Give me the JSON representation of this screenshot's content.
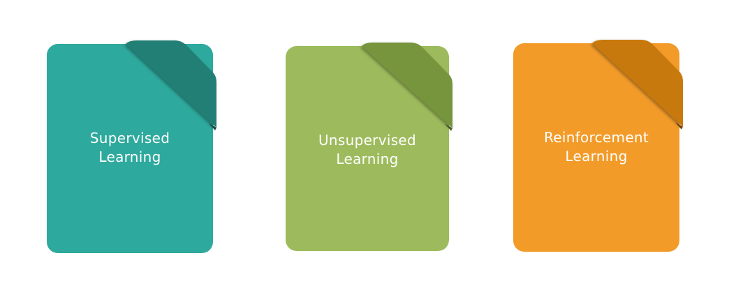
{
  "cards": [
    {
      "line1": "Supervised",
      "line2": "Learning",
      "color": "#2ea99d",
      "ribbon": "#217f74",
      "shade": "#16574f"
    },
    {
      "line1": "Unsupervised",
      "line2": "Learning",
      "color": "#9dbb5c",
      "ribbon": "#76953c",
      "shade": "#4f6627"
    },
    {
      "line1": "Reinforcement",
      "line2": "Learning",
      "color": "#f29b29",
      "ribbon": "#c8790c",
      "shade": "#7f4d08"
    }
  ]
}
